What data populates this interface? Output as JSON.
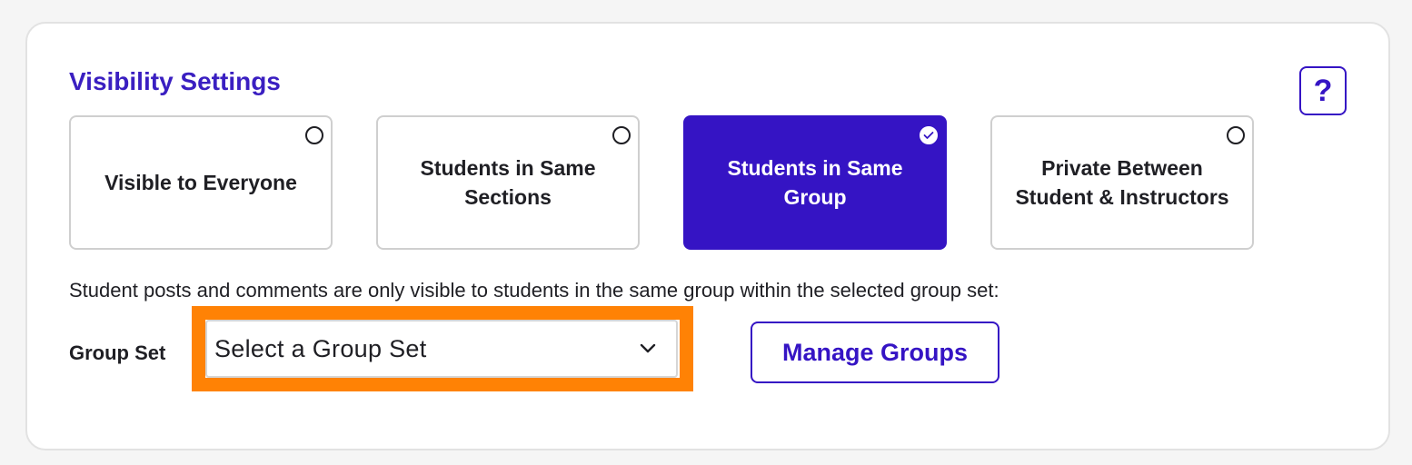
{
  "visibility": {
    "title": "Visibility Settings",
    "help_label": "?",
    "options": [
      {
        "label": "Visible to Everyone",
        "selected": false
      },
      {
        "label": "Students in Same Sections",
        "selected": false
      },
      {
        "label": "Students in Same Group",
        "selected": true
      },
      {
        "label": "Private Between Student & Instructors",
        "selected": false
      }
    ],
    "description": "Student posts and comments are only visible to students in the same group within the selected group set:"
  },
  "group_set": {
    "label": "Group Set",
    "selected_value": "Select a Group Set"
  },
  "manage_groups_label": "Manage Groups",
  "colors": {
    "accent": "#3514c4",
    "title": "#3a1fc1",
    "highlight": "#ff8205"
  },
  "icons": {
    "help": "question-mark-icon",
    "radio": "radio-circle-icon",
    "check": "checkmark-icon",
    "dropdown": "chevron-down-icon"
  }
}
